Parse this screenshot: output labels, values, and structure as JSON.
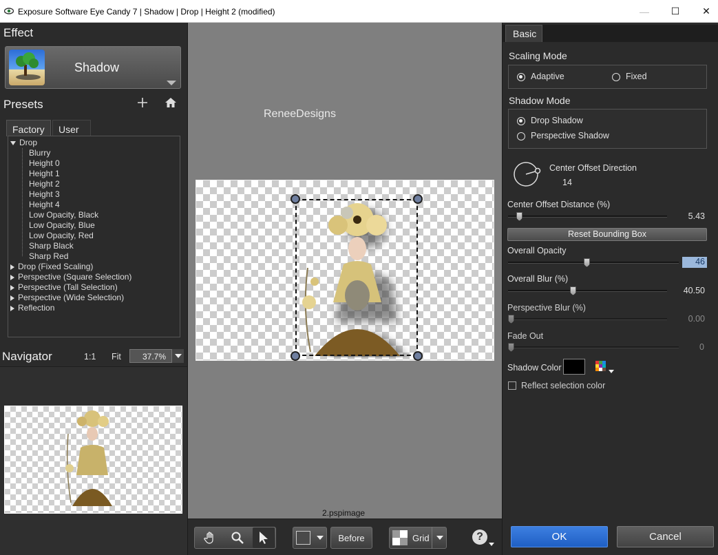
{
  "window": {
    "title": "Exposure Software Eye Candy 7 | Shadow | Drop | Height 2 (modified)",
    "minimize": "—",
    "maximize": "☐",
    "close": "✕"
  },
  "effect": {
    "section_title": "Effect",
    "name": "Shadow"
  },
  "presets": {
    "section_title": "Presets",
    "tabs": [
      "Factory",
      "User"
    ],
    "tree": [
      {
        "label": "Drop",
        "expanded": true,
        "children": [
          "Blurry",
          "Height 0",
          "Height 1",
          "Height 2",
          "Height 3",
          "Height 4",
          "Low Opacity, Black",
          "Low Opacity, Blue",
          "Low Opacity, Red",
          "Sharp Black",
          "Sharp Red"
        ]
      },
      {
        "label": "Drop (Fixed Scaling)",
        "expanded": false
      },
      {
        "label": "Perspective (Square Selection)",
        "expanded": false
      },
      {
        "label": "Perspective (Tall Selection)",
        "expanded": false
      },
      {
        "label": "Perspective (Wide Selection)",
        "expanded": false
      },
      {
        "label": "Reflection",
        "expanded": false
      }
    ]
  },
  "navigator": {
    "section_title": "Navigator",
    "one_to_one": "1:1",
    "fit": "Fit",
    "zoom": "37.7%"
  },
  "preview": {
    "watermark": "ReneeDesigns",
    "filename": "2.pspimage"
  },
  "toolbar": {
    "before_label": "Before",
    "grid_label": "Grid",
    "help_label": "?"
  },
  "controls": {
    "tab": "Basic",
    "scaling_mode": {
      "title": "Scaling Mode",
      "options": [
        "Adaptive",
        "Fixed"
      ],
      "selected": "Adaptive"
    },
    "shadow_mode": {
      "title": "Shadow Mode",
      "options": [
        "Drop Shadow",
        "Perspective Shadow"
      ],
      "selected": "Drop Shadow"
    },
    "center_offset_direction": {
      "label": "Center Offset Direction",
      "value": "14"
    },
    "center_offset_distance": {
      "label": "Center Offset Distance (%)",
      "value": "5.43",
      "fraction": 0.054
    },
    "reset_bbox": "Reset Bounding Box",
    "overall_opacity": {
      "label": "Overall Opacity",
      "value": "46",
      "fraction": 0.46
    },
    "overall_blur": {
      "label": "Overall Blur (%)",
      "value": "40.50",
      "fraction": 0.405
    },
    "perspective_blur": {
      "label": "Perspective Blur (%)",
      "value": "0.00",
      "fraction": 0
    },
    "fade_out": {
      "label": "Fade Out",
      "value": "0",
      "fraction": 0
    },
    "shadow_color": {
      "label": "Shadow Color",
      "color": "#000000"
    },
    "reflect_selection_color": {
      "label": "Reflect selection color",
      "checked": false
    },
    "ok": "OK",
    "cancel": "Cancel"
  },
  "colors": {
    "accent": "#1f5fc4",
    "panel": "#2b2b2b",
    "preview_bg": "#7f7f7f"
  }
}
